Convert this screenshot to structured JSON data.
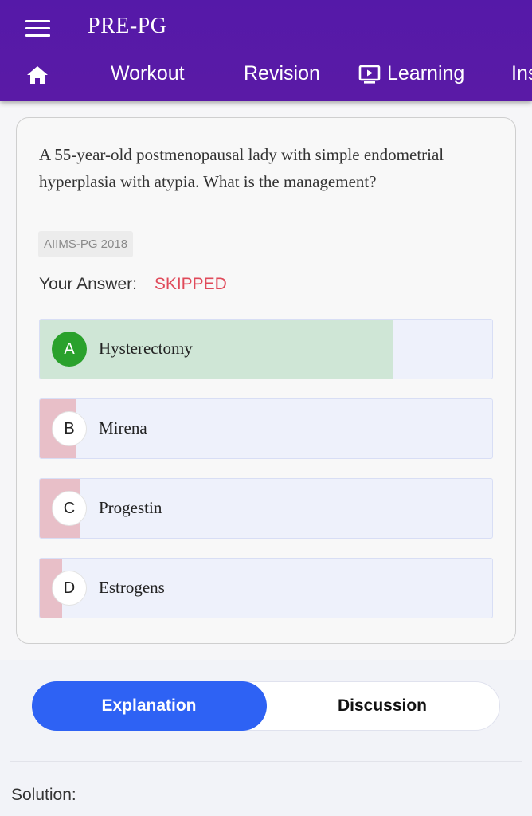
{
  "app": {
    "title": "PRE-PG"
  },
  "nav": {
    "tabs": [
      {
        "label": "Workout"
      },
      {
        "label": "Revision"
      },
      {
        "label": "Learning",
        "icon": "play-screen-icon"
      },
      {
        "label": "Ins"
      }
    ]
  },
  "question": {
    "text": "A 55-year-old postmenopausal lady with simple endometrial hyperplasia with atypia. What is the management?",
    "exam_tag": "AIIMS-PG 2018",
    "answer_label": "Your Answer:",
    "answer_value": "SKIPPED",
    "options": [
      {
        "letter": "A",
        "text": "Hysterectomy",
        "correct": true,
        "percent": 78
      },
      {
        "letter": "B",
        "text": "Mirena",
        "correct": false,
        "percent": 8
      },
      {
        "letter": "C",
        "text": "Progestin",
        "correct": false,
        "percent": 9
      },
      {
        "letter": "D",
        "text": "Estrogens",
        "correct": false,
        "percent": 5
      }
    ]
  },
  "tabs": {
    "explanation": "Explanation",
    "discussion": "Discussion"
  },
  "solution_label": "Solution:",
  "colors": {
    "header": "#5519a8",
    "correct_fill": "#cfe6d6",
    "wrong_fill": "#e8bfc8",
    "skipped": "#e04a5a",
    "active_tab": "#2e62f4"
  }
}
